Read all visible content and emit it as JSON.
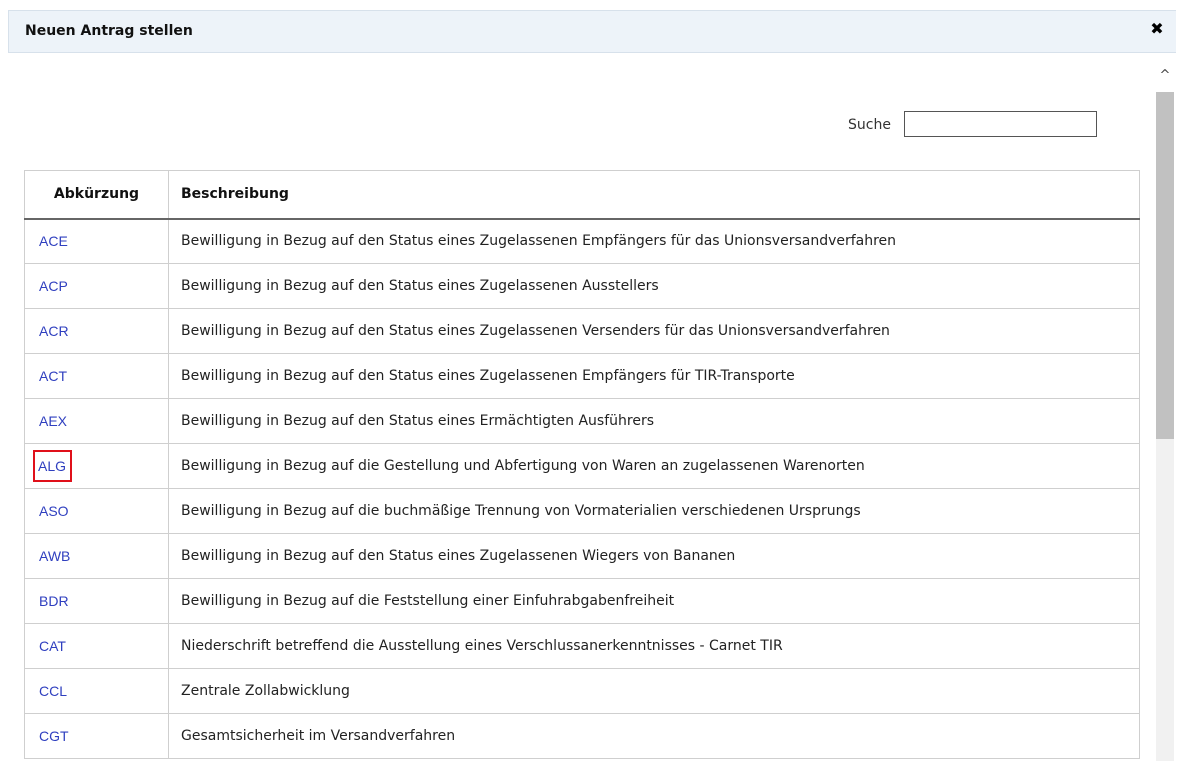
{
  "dialog": {
    "title": "Neuen Antrag stellen",
    "close_icon": "close-icon"
  },
  "search": {
    "label": "Suche",
    "value": ""
  },
  "table": {
    "headers": [
      "Abkürzung",
      "Beschreibung"
    ],
    "rows": [
      {
        "abbr": "ACE",
        "desc": "Bewilligung in Bezug auf den Status eines Zugelassenen Empfängers für das Unionsversandverfahren"
      },
      {
        "abbr": "ACP",
        "desc": "Bewilligung in Bezug auf den Status eines Zugelassenen Ausstellers"
      },
      {
        "abbr": "ACR",
        "desc": "Bewilligung in Bezug auf den Status eines Zugelassenen Versenders für das Unionsversandverfahren"
      },
      {
        "abbr": "ACT",
        "desc": "Bewilligung in Bezug auf den Status eines Zugelassenen Empfängers für TIR-Transporte"
      },
      {
        "abbr": "AEX",
        "desc": "Bewilligung in Bezug auf den Status eines Ermächtigten Ausführers"
      },
      {
        "abbr": "ALG",
        "desc": "Bewilligung in Bezug auf die Gestellung und Abfertigung von Waren an zugelassenen Warenorten",
        "highlighted": true
      },
      {
        "abbr": "ASO",
        "desc": "Bewilligung in Bezug auf die buchmäßige Trennung von Vormaterialien verschiedenen Ursprungs"
      },
      {
        "abbr": "AWB",
        "desc": "Bewilligung in Bezug auf den Status eines Zugelassenen Wiegers von Bananen"
      },
      {
        "abbr": "BDR",
        "desc": "Bewilligung in Bezug auf die Feststellung einer Einfuhrabgabenfreiheit"
      },
      {
        "abbr": "CAT",
        "desc": "Niederschrift betreffend die Ausstellung eines Verschlussanerkenntnisses - Carnet TIR"
      },
      {
        "abbr": "CCL",
        "desc": "Zentrale Zollabwicklung"
      },
      {
        "abbr": "CGT",
        "desc": "Gesamtsicherheit im Versandverfahren"
      }
    ]
  },
  "colors": {
    "link": "#2f3fbf",
    "highlight": "#e0101a",
    "titlebar": "#edf3f9"
  }
}
